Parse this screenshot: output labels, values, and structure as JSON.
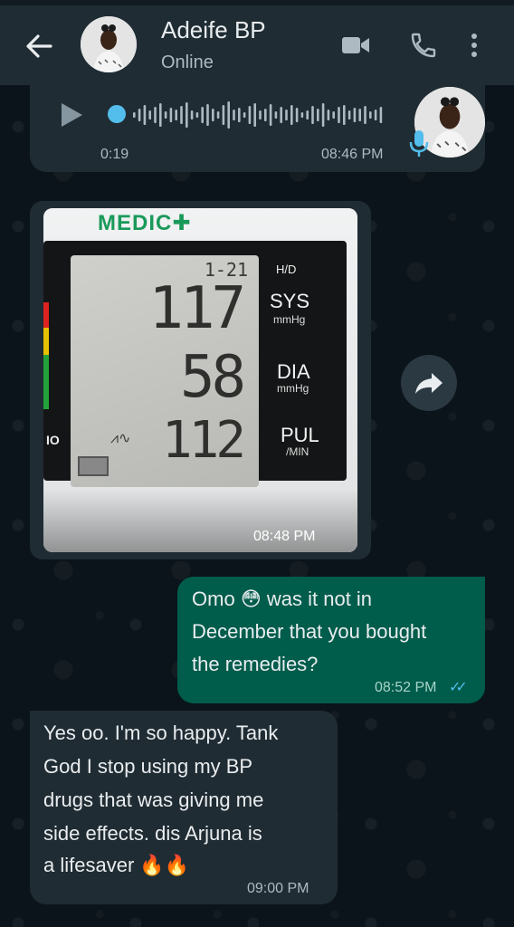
{
  "header": {
    "contact_name": "Adeife BP",
    "status": "Online"
  },
  "voice_message": {
    "duration": "0:19",
    "time": "08:46 PM",
    "progress": 0
  },
  "image_message": {
    "brand": "MEDIC",
    "labels": {
      "hd": "H/D",
      "sys": "SYS",
      "sys_unit": "mmHg",
      "dia": "DIA",
      "dia_unit": "mmHg",
      "pul": "PUL",
      "pul_unit": "/MIN"
    },
    "readings": {
      "date": "1-21",
      "sys": "117",
      "dia": "58",
      "pul": "112"
    },
    "side_fragment": "IO",
    "time": "08:48 PM"
  },
  "outgoing_message": {
    "text_part1": "Omo",
    "emoji": "😳",
    "text_line1_rest": "was it not in",
    "text_line2": "December that you bought",
    "text_line3": "the remedies?",
    "time": "08:52 PM",
    "ticks": "✓✓"
  },
  "incoming_message": {
    "line1": "Yes oo. I'm so happy. Tank",
    "line2": "God I stop using my BP",
    "line3": "drugs that was giving me",
    "line4": "side effects. dis Arjuna is",
    "line5": "a lifesaver",
    "emoji": "🔥🔥",
    "time": "09:00 PM"
  },
  "colors": {
    "header_bg": "#1f2c34",
    "chat_bg": "#0b141a",
    "incoming_bubble": "#202c33",
    "outgoing_bubble": "#005c4b",
    "accent": "#53bdeb",
    "brand_green": "#1a9a5a"
  }
}
